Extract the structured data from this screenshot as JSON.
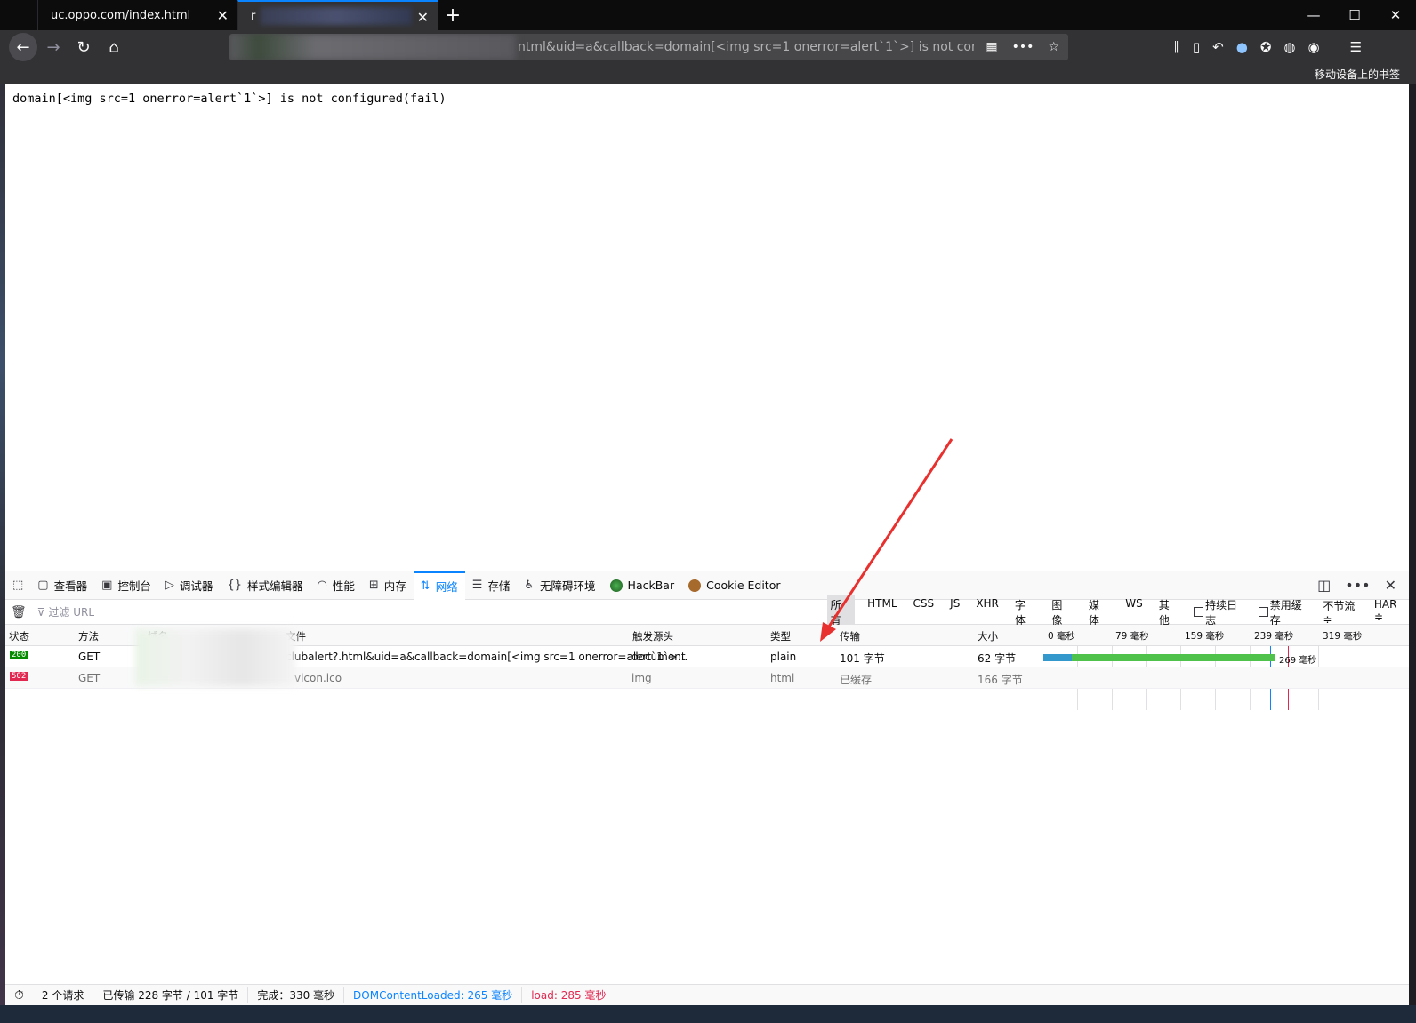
{
  "browser": {
    "tabs": [
      {
        "title": "uc.oppo.com/index.html"
      },
      {
        "title": "r"
      }
    ],
    "url_visible": "ntml&uid=a&callback=domain[<img src=1 onerror=alert`1`>] is not configu",
    "bookmarks_mobile": "移动设备上的书签"
  },
  "page": {
    "text": "domain[<img src=1 onerror=alert`1`>] is not configured(fail)"
  },
  "devtools": {
    "tabs": [
      {
        "icon": "inspector-icon",
        "label": "查看器"
      },
      {
        "icon": "console-icon",
        "label": "控制台"
      },
      {
        "icon": "debugger-icon",
        "label": "调试器"
      },
      {
        "icon": "style-editor-icon",
        "label": "样式编辑器"
      },
      {
        "icon": "performance-icon",
        "label": "性能"
      },
      {
        "icon": "memory-icon",
        "label": "内存"
      },
      {
        "icon": "network-icon",
        "label": "网络"
      },
      {
        "icon": "storage-icon",
        "label": "存储"
      },
      {
        "icon": "accessibility-icon",
        "label": "无障碍环境"
      },
      {
        "icon": "hackbar-icon",
        "label": "HackBar"
      },
      {
        "icon": "cookie-icon",
        "label": "Cookie Editor"
      }
    ],
    "filter_placeholder": "过滤 URL",
    "filter_types": [
      "所有",
      "HTML",
      "CSS",
      "JS",
      "XHR",
      "字体",
      "图像",
      "媒体",
      "WS",
      "其他"
    ],
    "persist_logs": "持续日志",
    "disable_cache": "禁用缓存",
    "throttle": "不节流 ≑",
    "har": "HAR ≑",
    "columns": [
      "状态",
      "方法",
      "域名",
      "文件",
      "触发源头",
      "类型",
      "传输",
      "大小"
    ],
    "timeline_ticks": [
      "0 毫秒",
      "79 毫秒",
      "159 毫秒",
      "239 毫秒",
      "319 毫秒"
    ],
    "rows": [
      {
        "status": "200",
        "method": "GET",
        "file": "clubalert?.html&uid=a&callback=domain[<img src=1 onerror=alert`1`>...",
        "cause": "document",
        "type": "plain",
        "transferred": "101 字节",
        "size": "62 字节",
        "timing_label": "269 毫秒"
      },
      {
        "status": "502",
        "method": "GET",
        "file": "vicon.ico",
        "cause": "img",
        "type": "html",
        "transferred": "已缓存",
        "size": "166 字节"
      }
    ],
    "summary": {
      "requests": "2 个请求",
      "transferred": "已传输 228 字节 / 101 字节",
      "finish": "完成：330 毫秒",
      "dom_loaded": "DOMContentLoaded: 265 毫秒",
      "load": "load: 285 毫秒"
    }
  },
  "colors": {
    "accent": "#0a84ff",
    "status_ok": "#058b00",
    "status_error": "#e22850",
    "annotation_arrow": "#e8312f"
  }
}
